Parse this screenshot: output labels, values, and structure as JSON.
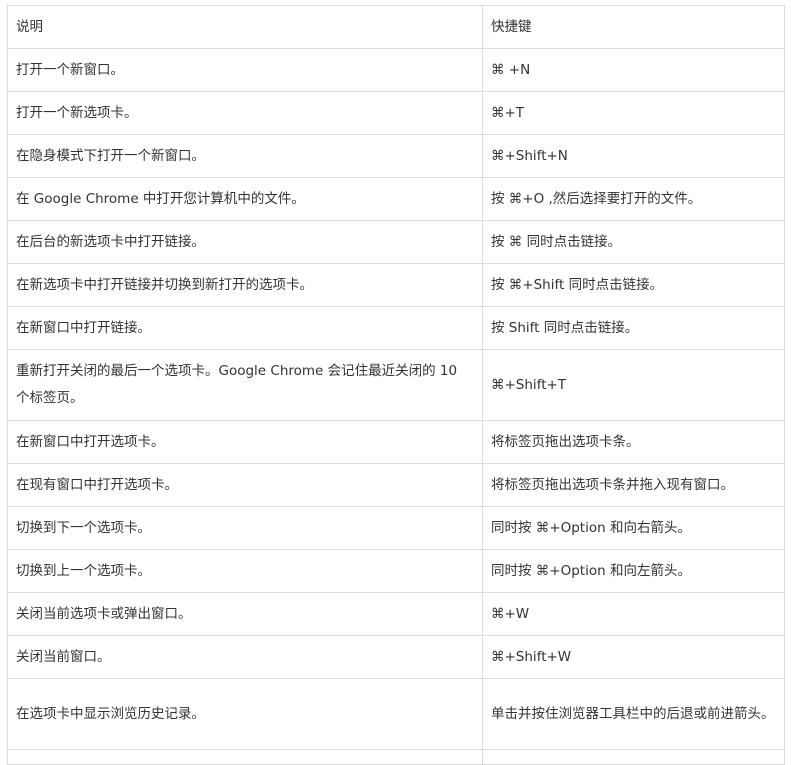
{
  "table": {
    "headers": [
      "说明",
      "快捷键"
    ],
    "rows": [
      [
        "打开一个新窗口。",
        "⌘ +N"
      ],
      [
        "打开一个新选项卡。",
        "⌘+T"
      ],
      [
        "在隐身模式下打开一个新窗口。",
        "⌘+Shift+N"
      ],
      [
        "在 Google Chrome 中打开您计算机中的文件。",
        "按 ⌘+O ,然后选择要打开的文件。"
      ],
      [
        "在后台的新选项卡中打开链接。",
        "按 ⌘ 同时点击链接。"
      ],
      [
        "在新选项卡中打开链接并切换到新打开的选项卡。",
        "按 ⌘+Shift 同时点击链接。"
      ],
      [
        "在新窗口中打开链接。",
        "按 Shift 同时点击链接。"
      ],
      [
        "重新打开关闭的最后一个选项卡。Google Chrome 会记住最近关闭的 10 个标签页。",
        "⌘+Shift+T"
      ],
      [
        "在新窗口中打开选项卡。",
        "将标签页拖出选项卡条。"
      ],
      [
        "在现有窗口中打开选项卡。",
        "将标签页拖出选项卡条并拖入现有窗口。"
      ],
      [
        "切换到下一个选项卡。",
        "同时按 ⌘+Option 和向右箭头。"
      ],
      [
        "切换到上一个选项卡。",
        "同时按 ⌘+Option 和向左箭头。"
      ],
      [
        "关闭当前选项卡或弹出窗口。",
        "⌘+W"
      ],
      [
        "关闭当前窗口。",
        "⌘+Shift+W"
      ],
      [
        "在选项卡中显示浏览历史记录。",
        "单击并按住浏览器工具栏中的后退或前进箭头。"
      ]
    ]
  }
}
